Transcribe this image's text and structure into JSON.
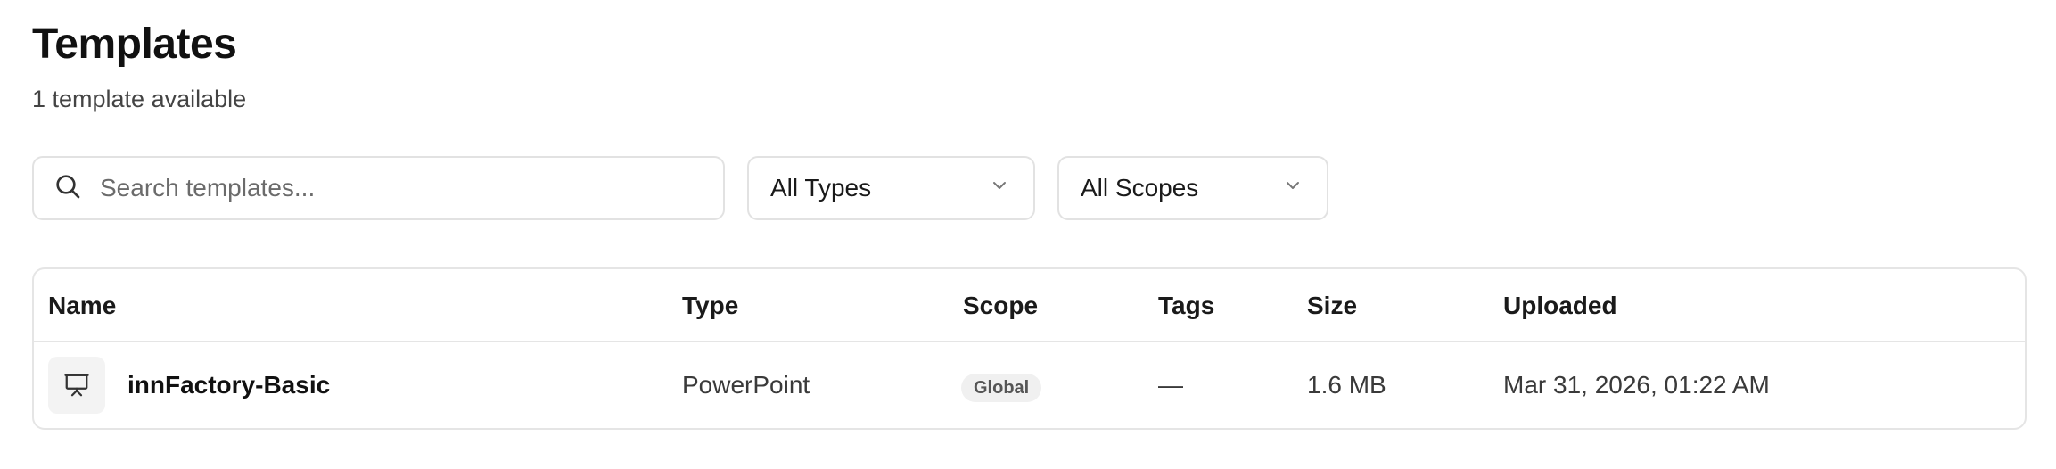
{
  "header": {
    "title": "Templates",
    "subtitle": "1 template available"
  },
  "filters": {
    "search_placeholder": "Search templates...",
    "type_select": "All Types",
    "scope_select": "All Scopes"
  },
  "table": {
    "columns": [
      "Name",
      "Type",
      "Scope",
      "Tags",
      "Size",
      "Uploaded"
    ],
    "rows": [
      {
        "icon": "presentation-icon",
        "name": "innFactory-Basic",
        "type": "PowerPoint",
        "scope": "Global",
        "tags": "—",
        "size": "1.6 MB",
        "uploaded": "Mar 31, 2026, 01:22 AM"
      }
    ]
  },
  "icons": {
    "search": "search-icon",
    "chevron": "chevron-down-icon"
  }
}
